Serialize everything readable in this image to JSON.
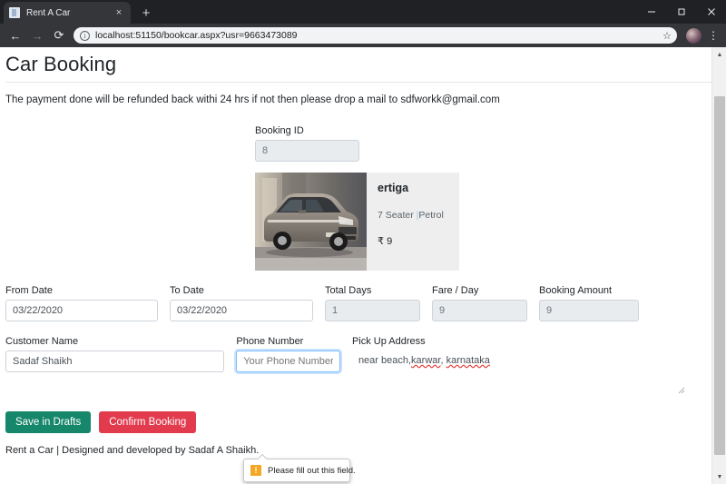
{
  "browser": {
    "tab": {
      "title": "Rent A Car",
      "favicon": "document-icon",
      "close": "×"
    },
    "new_tab": "+",
    "window_controls": {
      "minimize": "minimize-icon",
      "maximize": "maximize-icon",
      "close": "close-icon"
    },
    "nav": {
      "back": "←",
      "forward": "→",
      "reload": "⟳"
    },
    "omnibox": {
      "url": "localhost:51150/bookcar.aspx?usr=9663473089",
      "info_icon": "ⓘ",
      "star_icon": "☆"
    },
    "profile": "avatar",
    "menu": "⋮"
  },
  "page": {
    "title": "Car Booking",
    "notice": "The payment done will be refunded back withi 24 hrs if not then please drop a mail to sdfworkk@gmail.com",
    "booking_id": {
      "label": "Booking ID",
      "value": "8"
    },
    "car": {
      "name": "ertiga",
      "seats": "7  Seater",
      "separator": "|",
      "fuel": "Petrol",
      "currency": "₹",
      "price": "9",
      "photo_alt": "ertiga-car-photo"
    },
    "fields": {
      "from_date": {
        "label": "From Date",
        "value": "03/22/2020"
      },
      "to_date": {
        "label": "To Date",
        "value": "03/22/2020"
      },
      "total_days": {
        "label": "Total Days",
        "value": "1"
      },
      "fare_per_day": {
        "label": "Fare / Day",
        "value": "9"
      },
      "booking_amount": {
        "label": "Booking Amount",
        "value": "9"
      },
      "customer_name": {
        "label": "Customer Name",
        "value": "Sadaf Shaikh"
      },
      "phone_number": {
        "label": "Phone Number",
        "value": "",
        "placeholder": "Your Phone Number"
      },
      "pickup_address": {
        "label": "Pick Up Address",
        "value_plain": "near beach,karwar, karnataka",
        "part1": "near beach,",
        "part2": "karwar",
        "part3": ", ",
        "part4": "karnataka"
      }
    },
    "validation_tooltip": {
      "icon": "!",
      "text": "Please fill out this field."
    },
    "buttons": {
      "save_drafts": "Save in Drafts",
      "confirm_booking": "Confirm Booking"
    },
    "footer": "Rent a Car | Designed and developed by Sadaf A Shaikh."
  },
  "colors": {
    "btn_draft": "#17876b",
    "btn_confirm": "#e23b4e",
    "focus_border": "#80bdff",
    "warning": "#f5a623",
    "card_bg": "#eeeeee"
  },
  "scrollbar": {
    "up": "▲",
    "down": "▼"
  }
}
